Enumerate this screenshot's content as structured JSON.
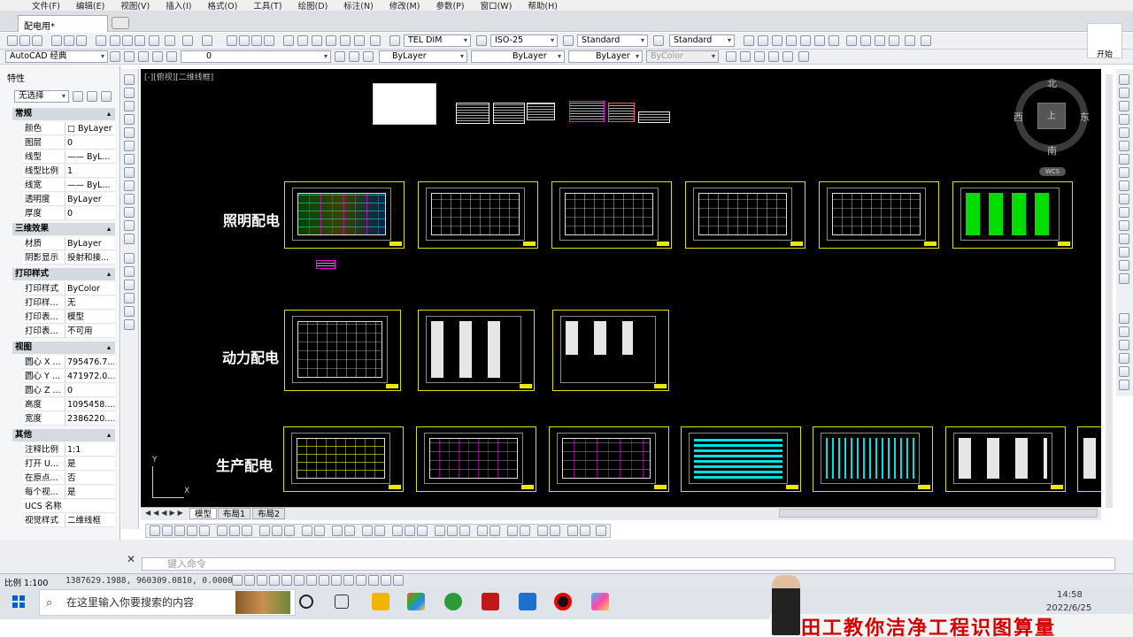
{
  "menu": [
    "文件(F)",
    "编辑(E)",
    "视图(V)",
    "插入(I)",
    "格式(O)",
    "工具(T)",
    "绘图(D)",
    "标注(N)",
    "修改(M)",
    "参数(P)",
    "窗口(W)",
    "帮助(H)"
  ],
  "document_tab": "配电用*",
  "start_button": "开始",
  "toolbar": {
    "text_style": "TEL DIM",
    "dim_style": "ISO-25",
    "table_style": "Standard",
    "multileader_style": "Standard",
    "workspace": "AutoCAD 经典",
    "layer": "0",
    "color": "ByLayer",
    "linetype": "ByLayer",
    "lineweight": "ByLayer",
    "plot_style": "ByColor"
  },
  "properties": {
    "title": "特性",
    "selection": "无选择",
    "sections": [
      {
        "name": "常规",
        "rows": [
          {
            "k": "颜色",
            "v": "□ ByLayer"
          },
          {
            "k": "图层",
            "v": "0"
          },
          {
            "k": "线型",
            "v": "—— ByL..."
          },
          {
            "k": "线型比例",
            "v": "1"
          },
          {
            "k": "线宽",
            "v": "—— ByL..."
          },
          {
            "k": "透明度",
            "v": "ByLayer"
          },
          {
            "k": "厚度",
            "v": "0"
          }
        ]
      },
      {
        "name": "三维效果",
        "rows": [
          {
            "k": "材质",
            "v": "ByLayer"
          },
          {
            "k": "阴影显示",
            "v": "投射和接..."
          }
        ]
      },
      {
        "name": "打印样式",
        "rows": [
          {
            "k": "打印样式",
            "v": "ByColor"
          },
          {
            "k": "打印样...",
            "v": "无"
          },
          {
            "k": "打印表...",
            "v": "模型"
          },
          {
            "k": "打印表...",
            "v": "不可用"
          }
        ]
      },
      {
        "name": "视图",
        "rows": [
          {
            "k": "圆心 X ...",
            "v": "795476.7..."
          },
          {
            "k": "圆心 Y ...",
            "v": "471972.0..."
          },
          {
            "k": "圆心 Z ...",
            "v": "0"
          },
          {
            "k": "高度",
            "v": "1095458...."
          },
          {
            "k": "宽度",
            "v": "2386220...."
          }
        ]
      },
      {
        "name": "其他",
        "rows": [
          {
            "k": "注释比例",
            "v": "1:1"
          },
          {
            "k": "打开 U...",
            "v": "是"
          },
          {
            "k": "在原点...",
            "v": "否"
          },
          {
            "k": "每个视...",
            "v": "是"
          },
          {
            "k": "UCS 名称",
            "v": ""
          },
          {
            "k": "视觉样式",
            "v": "二维线框"
          }
        ]
      }
    ]
  },
  "viewport_label": "[-][俯视][二维线框]",
  "drawing_groups": [
    "照明配电",
    "动力配电",
    "生产配电"
  ],
  "compass": {
    "north": "北",
    "south": "南",
    "east": "东",
    "west": "西",
    "center": "上",
    "wcs": "WCS"
  },
  "ucs": {
    "x": "X",
    "y": "Y"
  },
  "layout_tabs": [
    "模型",
    "布局1",
    "布局2"
  ],
  "command_placeholder": "键入命令",
  "status": {
    "scale": "比例 1:100",
    "coordinates": "1387629.1988, 960309.0810, 0.0000"
  },
  "taskbar": {
    "search_placeholder": "在这里输入你要搜索的内容",
    "time": "14:58",
    "date": "2022/6/25"
  },
  "banner": "田工教你洁净工程识图算量"
}
